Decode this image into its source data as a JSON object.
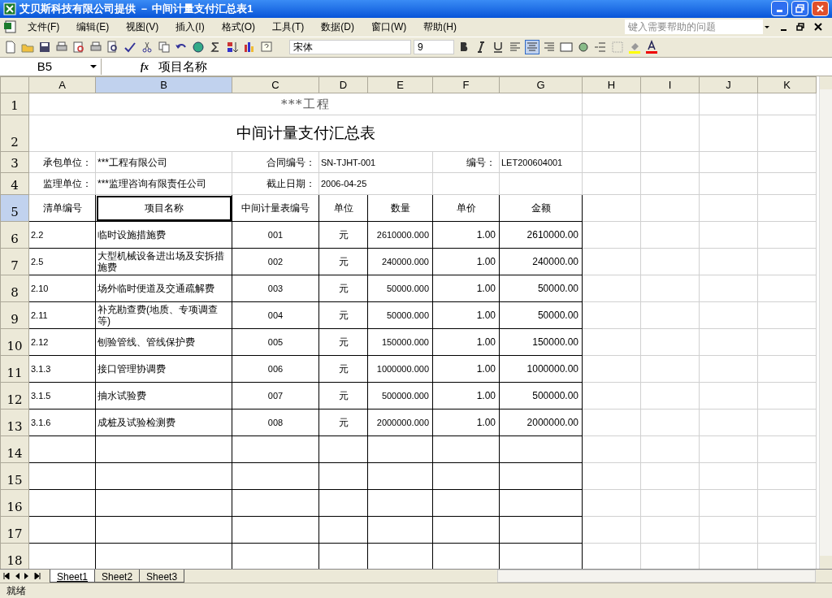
{
  "window": {
    "title": "艾贝斯科技有限公司提供 － 中间计量支付汇总表1"
  },
  "menu": [
    "文件(F)",
    "编辑(E)",
    "视图(V)",
    "插入(I)",
    "格式(O)",
    "工具(T)",
    "数据(D)",
    "窗口(W)",
    "帮助(H)"
  ],
  "help_box": {
    "placeholder": "键入需要帮助的问题"
  },
  "toolbar": {
    "font": "宋体",
    "size": "9"
  },
  "formula_bar": {
    "name_box": "B5",
    "function_label": "fx",
    "value": "项目名称"
  },
  "columns": [
    {
      "label": "A",
      "selected": false
    },
    {
      "label": "B",
      "selected": true
    },
    {
      "label": "C",
      "selected": false
    },
    {
      "label": "D",
      "selected": false
    },
    {
      "label": "E",
      "selected": false
    },
    {
      "label": "F",
      "selected": false
    },
    {
      "label": "G",
      "selected": false
    },
    {
      "label": "H",
      "selected": false
    },
    {
      "label": "I",
      "selected": false
    },
    {
      "label": "J",
      "selected": false
    },
    {
      "label": "K",
      "selected": false
    }
  ],
  "rows": [
    {
      "label": "1",
      "selected": false
    },
    {
      "label": "2",
      "selected": false
    },
    {
      "label": "3",
      "selected": false
    },
    {
      "label": "4",
      "selected": false
    },
    {
      "label": "5",
      "selected": true
    },
    {
      "label": "6",
      "selected": false
    },
    {
      "label": "7",
      "selected": false
    },
    {
      "label": "8",
      "selected": false
    },
    {
      "label": "9",
      "selected": false
    },
    {
      "label": "10",
      "selected": false
    },
    {
      "label": "11",
      "selected": false
    },
    {
      "label": "12",
      "selected": false
    },
    {
      "label": "13",
      "selected": false
    },
    {
      "label": "14",
      "selected": false
    },
    {
      "label": "15",
      "selected": false
    },
    {
      "label": "16",
      "selected": false
    },
    {
      "label": "17",
      "selected": false
    },
    {
      "label": "18",
      "selected": false
    }
  ],
  "sheet": {
    "project": "***工程",
    "heading": "中间计量支付汇总表",
    "info": [
      {
        "label": "承包单位：",
        "value": "***工程有限公司",
        "label2": "合同编号：",
        "value2": "SN-TJHT-001",
        "label3": "编号：",
        "value3": "LET200604001"
      },
      {
        "label": "监理单位：",
        "value": "***监理咨询有限责任公司",
        "label2": "截止日期：",
        "value2": "2006-04-25"
      }
    ],
    "header": [
      "清单编号",
      "项目名称",
      "中间计量表编号",
      "单位",
      "数量",
      "单价",
      "金额"
    ],
    "items": [
      [
        "2.2",
        "临时设施措施费",
        "001",
        "元",
        "2610000.000",
        "1.00",
        "2610000.00"
      ],
      [
        "2.5",
        "大型机械设备进出场及安拆措施费",
        "002",
        "元",
        "240000.000",
        "1.00",
        "240000.00"
      ],
      [
        "2.10",
        "场外临时便道及交通疏解费",
        "003",
        "元",
        "50000.000",
        "1.00",
        "50000.00"
      ],
      [
        "2.11",
        "补充勘查费(地质、专项调查等)",
        "004",
        "元",
        "50000.000",
        "1.00",
        "50000.00"
      ],
      [
        "2.12",
        "刨验管线、管线保护费",
        "005",
        "元",
        "150000.000",
        "1.00",
        "150000.00"
      ],
      [
        "3.1.3",
        "接口管理协调费",
        "006",
        "元",
        "1000000.000",
        "1.00",
        "1000000.00"
      ],
      [
        "3.1.5",
        "抽水试验费",
        "007",
        "元",
        "500000.000",
        "1.00",
        "500000.00"
      ],
      [
        "3.1.6",
        "成桩及试验检测费",
        "008",
        "元",
        "2000000.000",
        "1.00",
        "2000000.00"
      ]
    ]
  },
  "sheet_tabs": [
    {
      "label": "Sheet1",
      "selected": true
    },
    {
      "label": "Sheet2",
      "selected": false
    },
    {
      "label": "Sheet3",
      "selected": false
    }
  ],
  "status_bar": "就绪"
}
